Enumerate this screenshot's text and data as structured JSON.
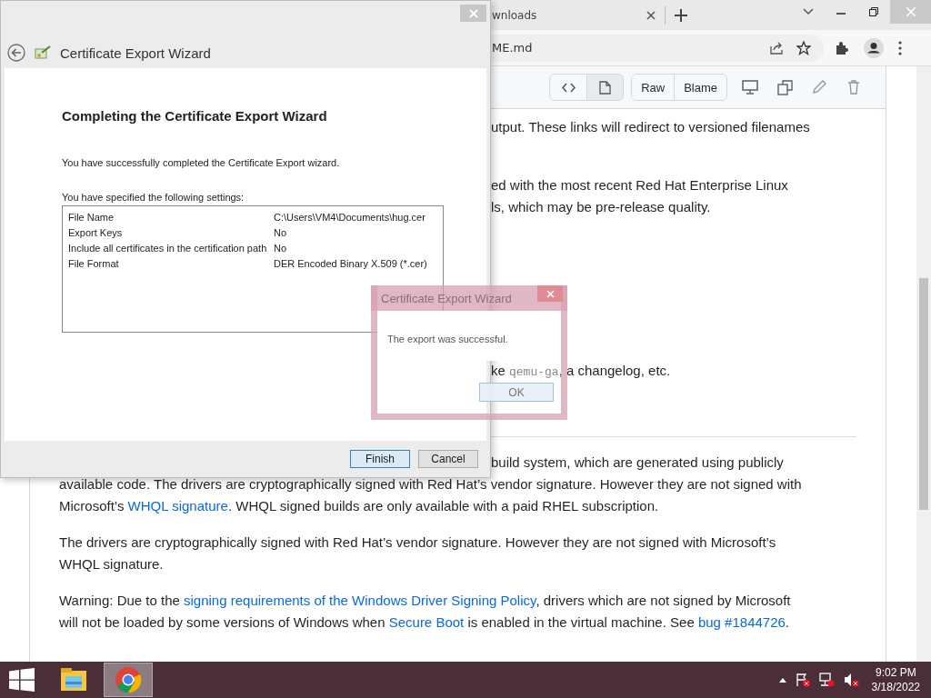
{
  "browser": {
    "tab": {
      "title": "wnloads"
    },
    "address": "ME.md",
    "file_toolbar": {
      "view_toggle": [
        {
          "kind": "code",
          "selected": false
        },
        {
          "kind": "preview",
          "selected": true
        }
      ],
      "buttons": [
        "Raw",
        "Blame"
      ]
    },
    "content": [
      {
        "kind": "paragraph",
        "lines": [
          {
            "kind": "partial",
            "parts": [
              {
                "kind": "text",
                "text": "utput. These links will redirect to versioned filenames"
              }
            ]
          }
        ]
      },
      {
        "kind": "paragraph",
        "lines": [
          {
            "kind": "partial",
            "parts": [
              {
                "kind": "text",
                "text": "ed with the most recent Red Hat Enterprise Linux"
              }
            ]
          },
          {
            "kind": "partial",
            "parts": [
              {
                "kind": "text",
                "text": "ls, which may be pre-release quality."
              }
            ]
          }
        ]
      },
      {
        "kind": "paragraph",
        "lines": [
          {
            "kind": "partial",
            "parts": [
              {
                "kind": "text",
                "text": "ke "
              },
              {
                "kind": "code",
                "text": "qemu-ga"
              },
              {
                "kind": "text",
                "text": ", a changelog, etc."
              }
            ]
          }
        ]
      },
      {
        "kind": "rule"
      },
      {
        "kind": "paragraph",
        "lines": [
          {
            "kind": "partial",
            "parts": [
              {
                "kind": "text",
                "text": "build system, which are generated using publicly"
              }
            ]
          },
          {
            "kind": "full",
            "parts": [
              {
                "kind": "text",
                "text": "available code. The drivers are cryptographically signed with Red Hat’s vendor signature. However they are not signed with"
              }
            ]
          },
          {
            "kind": "full",
            "parts": [
              {
                "kind": "text",
                "text": "Microsoft’s "
              },
              {
                "kind": "link",
                "text": "WHQL signature"
              },
              {
                "kind": "text",
                "text": ". WHQL signed builds are only available with a paid RHEL subscription."
              }
            ]
          }
        ]
      },
      {
        "kind": "paragraph",
        "lines": [
          {
            "kind": "full",
            "parts": [
              {
                "kind": "text",
                "text": "The drivers are cryptographically signed with Red Hat’s vendor signature. However they are not signed with Microsoft’s"
              }
            ]
          },
          {
            "kind": "full",
            "parts": [
              {
                "kind": "text",
                "text": "WHQL signature."
              }
            ]
          }
        ]
      },
      {
        "kind": "paragraph",
        "lines": [
          {
            "kind": "full",
            "parts": [
              {
                "kind": "text",
                "text": "Warning: Due to the "
              },
              {
                "kind": "link",
                "text": "signing requirements of the Windows Driver Signing Policy"
              },
              {
                "kind": "text",
                "text": ", drivers which are not signed by Microsoft"
              }
            ]
          },
          {
            "kind": "full",
            "parts": [
              {
                "kind": "text",
                "text": "will not be loaded by some versions of Windows when "
              },
              {
                "kind": "link",
                "text": "Secure Boot"
              },
              {
                "kind": "text",
                "text": " is enabled in the virtual machine. See "
              },
              {
                "kind": "link",
                "text": "bug #1844726"
              },
              {
                "kind": "text",
                "text": "."
              }
            ]
          }
        ]
      }
    ]
  },
  "wizard": {
    "title": "Certificate Export Wizard",
    "heading": "Completing the Certificate Export Wizard",
    "message": "You have successfully completed the Certificate Export wizard.",
    "settings_label": "You have specified the following settings:",
    "settings": [
      {
        "name": "File Name",
        "value": "C:\\Users\\VM4\\Documents\\hug.cer"
      },
      {
        "name": "Export Keys",
        "value": "No"
      },
      {
        "name": "Include all certificates in the certification path",
        "value": "No"
      },
      {
        "name": "File Format",
        "value": "DER Encoded Binary X.509 (*.cer)"
      }
    ],
    "buttons": [
      {
        "label": "Finish",
        "default": true
      },
      {
        "label": "Cancel",
        "default": false
      }
    ]
  },
  "message_box": {
    "title": "Certificate Export Wizard",
    "text": "The export was successful.",
    "button": "OK"
  },
  "taskbar": {
    "apps": [
      {
        "kind": "explorer",
        "active": false
      },
      {
        "kind": "chrome",
        "active": true
      }
    ],
    "time": "9:02 PM",
    "date": "3/18/2022"
  }
}
